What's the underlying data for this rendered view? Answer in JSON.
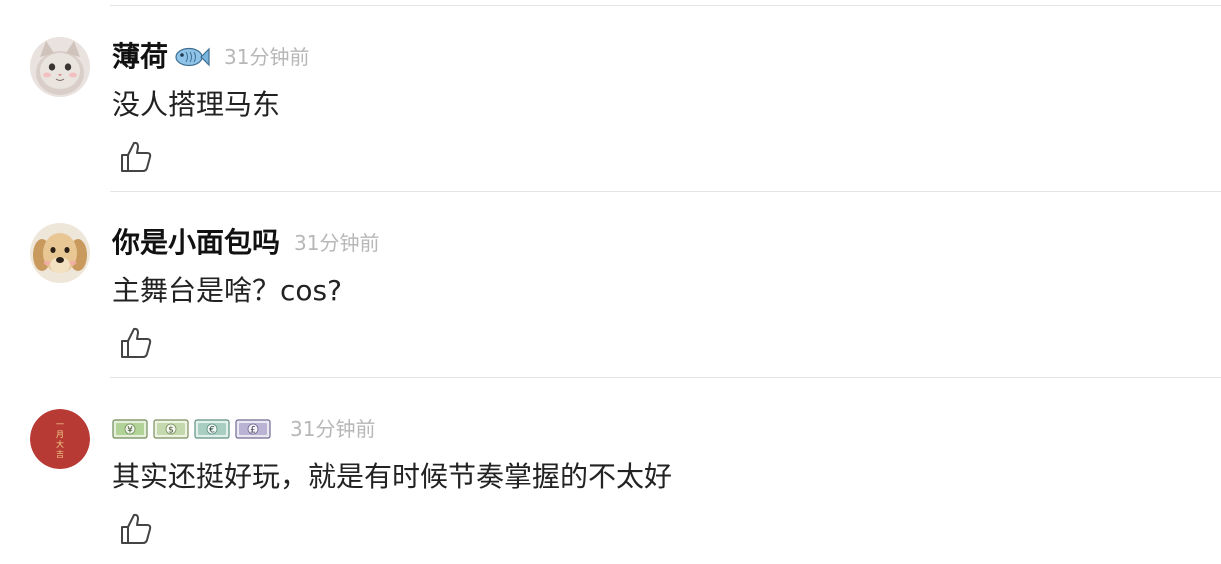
{
  "comments": [
    {
      "username": "薄荷",
      "username_badge_icon": "fish-icon",
      "timestamp": "31分钟前",
      "text": "没人搭理马东",
      "avatar_icon": "cat-avatar"
    },
    {
      "username": "你是小面包吗",
      "timestamp": "31分钟前",
      "text": "主舞台是啥？cos?",
      "avatar_icon": "dog-avatar"
    },
    {
      "username_badges": [
        {
          "icon": "yen-banknote-icon",
          "symbol": "¥",
          "color": "#8fbf6a"
        },
        {
          "icon": "dollar-banknote-icon",
          "symbol": "$",
          "color": "#a9c98a"
        },
        {
          "icon": "euro-banknote-icon",
          "symbol": "€",
          "color": "#7fb7a5"
        },
        {
          "icon": "pound-banknote-icon",
          "symbol": "£",
          "color": "#9a8fbf"
        }
      ],
      "timestamp": "31分钟前",
      "text": "其实还挺好玩，就是有时候节奏掌握的不太好",
      "avatar_text": "一月大吉",
      "avatar_color": "#b83a35"
    }
  ],
  "colors": {
    "divider": "#e4e4e4",
    "timestamp": "#b7b7b7",
    "like_icon": "#444444"
  }
}
